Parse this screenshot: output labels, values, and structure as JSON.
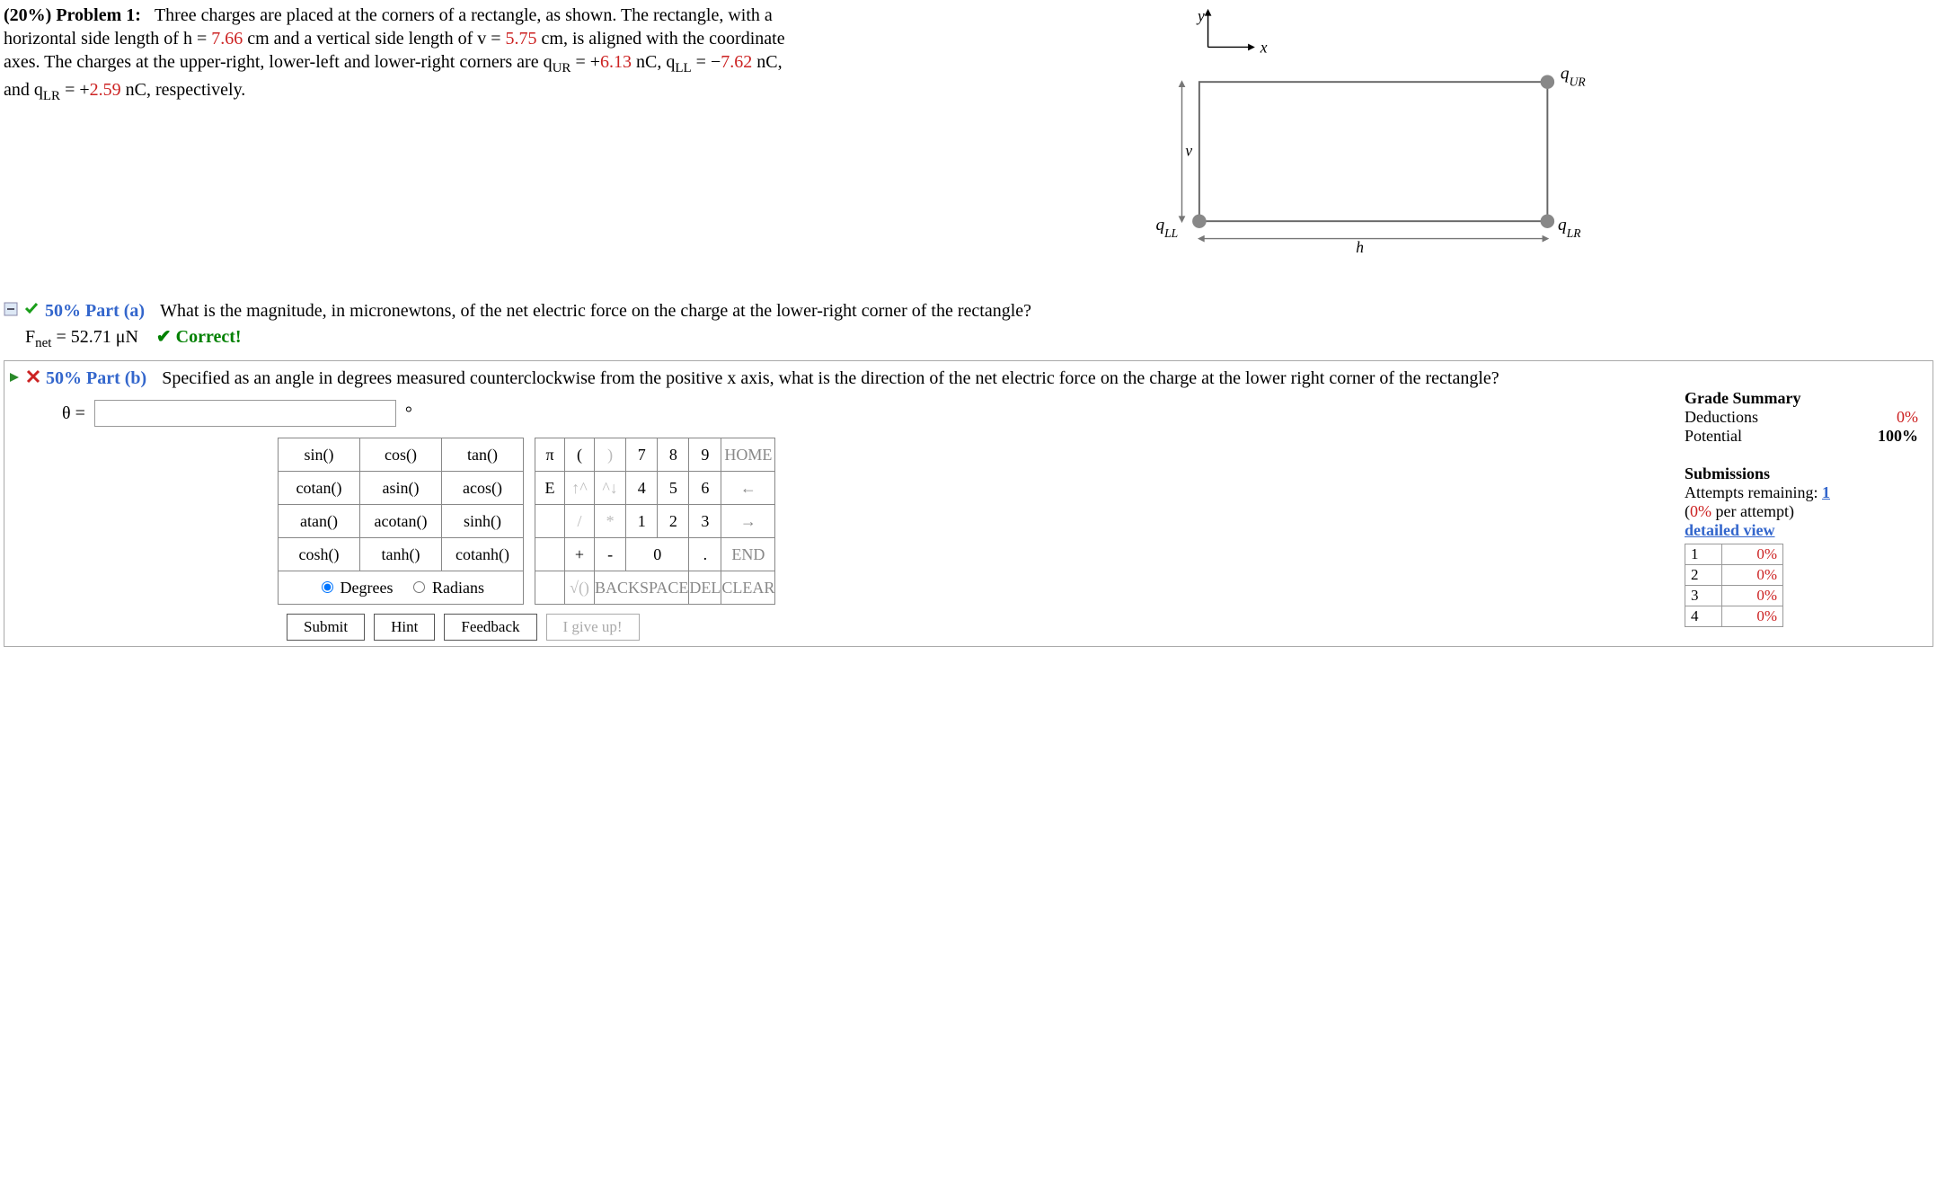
{
  "problem": {
    "weight": "(20%)",
    "label": "Problem 1:",
    "text1": "Three charges are placed at the corners of a rectangle, as shown. The rectangle, with a horizontal side length of h = ",
    "h_val": "7.66",
    "text2": " cm and a vertical side length of v = ",
    "v_val": "5.75",
    "text3": " cm, is aligned with the coordinate axes. The charges at the upper-right, lower-left and lower-right corners are q",
    "qur_eq": " = +",
    "qur_val": "6.13",
    "qll_eq": " = −",
    "qll_val": "7.62",
    "qlr_eq": " = +",
    "qlr_val": "2.59",
    "text4": " nC, respectively.",
    "nc": " nC, q",
    "nc_and": " nC, and q"
  },
  "figure": {
    "y": "y",
    "x": "x",
    "v": "v",
    "h": "h",
    "qur": "qUR",
    "qll": "qLL",
    "qlr": "qLR"
  },
  "part_a": {
    "weight": "50% Part (a)",
    "question": "What is the magnitude, in micronewtons, of the net electric force on the charge at the lower-right corner of the rectangle?",
    "answer_label": "F",
    "answer_sub": "net",
    "answer_eq": " = 52.71 μN",
    "correct": "✔ Correct!"
  },
  "part_b": {
    "weight": "50% Part (b)",
    "question": "Specified as an angle in degrees measured counterclockwise from the positive x axis, what is the direction of the net electric force on the charge at the lower right corner of the rectangle?",
    "theta": "θ ="
  },
  "funcpad": [
    [
      "sin()",
      "cos()",
      "tan()"
    ],
    [
      "cotan()",
      "asin()",
      "acos()"
    ],
    [
      "atan()",
      "acotan()",
      "sinh()"
    ],
    [
      "cosh()",
      "tanh()",
      "cotanh()"
    ]
  ],
  "mode": {
    "degrees": "Degrees",
    "radians": "Radians"
  },
  "sympad": {
    "r1": [
      "π",
      "(",
      ")",
      "7",
      "8",
      "9",
      "HOME"
    ],
    "r2": [
      "E",
      "↑^",
      "^↓",
      "4",
      "5",
      "6",
      "←"
    ],
    "r3": [
      "",
      "/",
      "*",
      "1",
      "2",
      "3",
      "→"
    ],
    "r4": [
      "",
      "+",
      "-",
      "0",
      ".",
      "END"
    ],
    "r5": [
      "",
      "√()",
      "BACKSPACE",
      "DEL",
      "CLEAR"
    ]
  },
  "action": {
    "submit": "Submit",
    "hint": "Hint",
    "feedback": "Feedback",
    "giveup": "I give up!"
  },
  "grade": {
    "summary": "Grade Summary",
    "ded": "Deductions",
    "ded_v": "0%",
    "pot": "Potential",
    "pot_v": "100%",
    "subs": "Submissions",
    "rem": "Attempts remaining: ",
    "rem_n": "1",
    "per": "(",
    "per_n": "0%",
    "per2": " per attempt)",
    "detail": "detailed view",
    "attempts": [
      [
        "1",
        "0%"
      ],
      [
        "2",
        "0%"
      ],
      [
        "3",
        "0%"
      ],
      [
        "4",
        "0%"
      ]
    ]
  }
}
